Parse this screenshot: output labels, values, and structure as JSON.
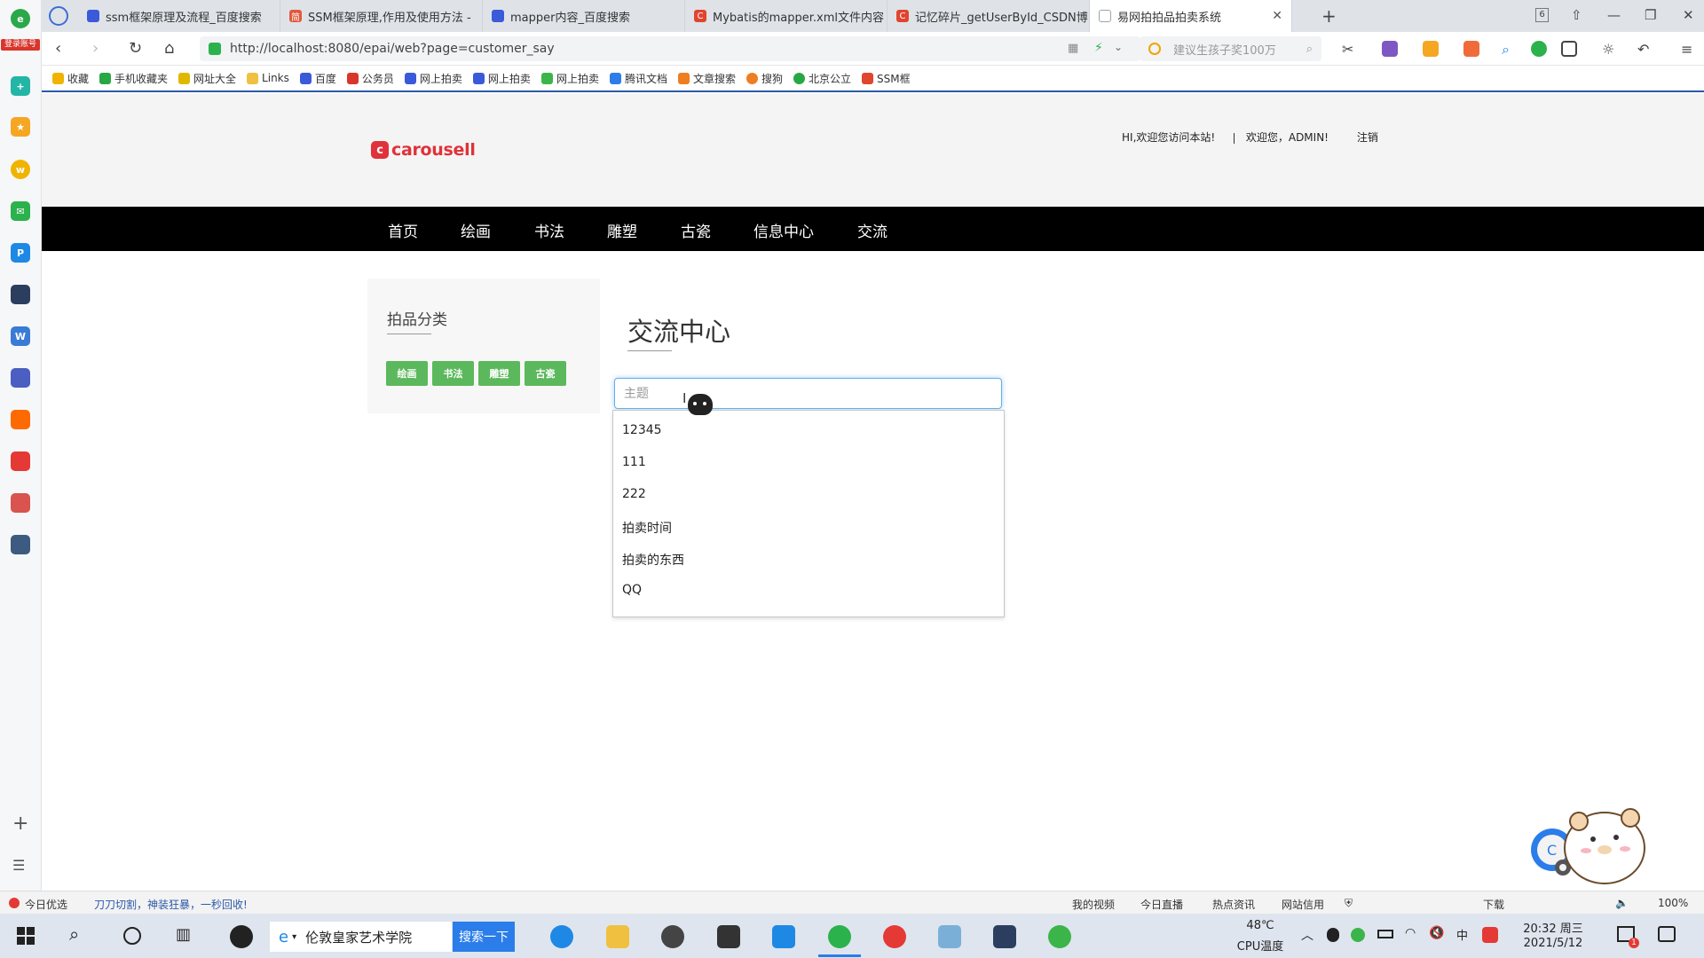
{
  "sidebar": {
    "badge": "登录账号"
  },
  "tabs": [
    {
      "label": "ssm框架原理及流程_百度搜索",
      "color": "#3a5ad9"
    },
    {
      "label": "SSM框架原理,作用及使用方法 -",
      "color": "#e05a3c"
    },
    {
      "label": "mapper内容_百度搜索",
      "color": "#3a5ad9"
    },
    {
      "label": "Mybatis的mapper.xml文件内容",
      "color": "#e0452f"
    },
    {
      "label": "记忆碎片_getUserById_CSDN博",
      "color": "#e0452f"
    },
    {
      "label": "易网拍拍品拍卖系统",
      "color": "#9aa3ad"
    }
  ],
  "tab_count": "6",
  "address": {
    "url": "http://localhost:8080/epai/web?page=customer_say"
  },
  "search": {
    "placeholder": "建议生孩子奖100万"
  },
  "bookmarks": [
    {
      "label": "收藏",
      "color": "#f0b400"
    },
    {
      "label": "手机收藏夹",
      "color": "#27a845"
    },
    {
      "label": "网址大全",
      "color": "#e0b800"
    },
    {
      "label": "Links",
      "color": "#f0c040"
    },
    {
      "label": "百度",
      "color": "#3a5ad9"
    },
    {
      "label": "公务员",
      "color": "#d9352b"
    },
    {
      "label": "网上拍卖",
      "color": "#3a5ad9"
    },
    {
      "label": "网上拍卖",
      "color": "#3a5ad9"
    },
    {
      "label": "网上拍卖",
      "color": "#3bb54a"
    },
    {
      "label": "腾讯文档",
      "color": "#2b7de9"
    },
    {
      "label": "文章搜索",
      "color": "#ef7d22"
    },
    {
      "label": "搜狗",
      "color": "#ef7d22"
    },
    {
      "label": "北京公立",
      "color": "#27a845"
    },
    {
      "label": "SSM框",
      "color": "#e0452f"
    }
  ],
  "site": {
    "logo": "carousell",
    "greeting": "HI,欢迎您访问本站!",
    "welcome": "欢迎您，ADMIN!",
    "logout": "注销",
    "nav": [
      "首页",
      "绘画",
      "书法",
      "雕塑",
      "古瓷",
      "信息中心",
      "交流"
    ],
    "category_title": "拍品分类",
    "categories": [
      "绘画",
      "书法",
      "雕塑",
      "古瓷"
    ],
    "page_title": "交流中心",
    "subject_placeholder": "主题",
    "suggestions": [
      "12345",
      "111",
      "222",
      "拍卖时间",
      "拍卖的东西",
      "QQ"
    ]
  },
  "statusbar": {
    "left1": "今日优选",
    "left2": "刀刀切割，神装狂暴，一秒回收!",
    "items": [
      "我的视频",
      "今日直播",
      "热点资讯",
      "网站信用"
    ],
    "download": "下载",
    "zoom": "100%"
  },
  "taskbar": {
    "search_text": "伦敦皇家艺术学院",
    "search_button": "搜索一下",
    "temp": "48℃",
    "temp_label": "CPU温度",
    "time": "20:32 周三",
    "date": "2021/5/12",
    "notif_count": "1"
  }
}
